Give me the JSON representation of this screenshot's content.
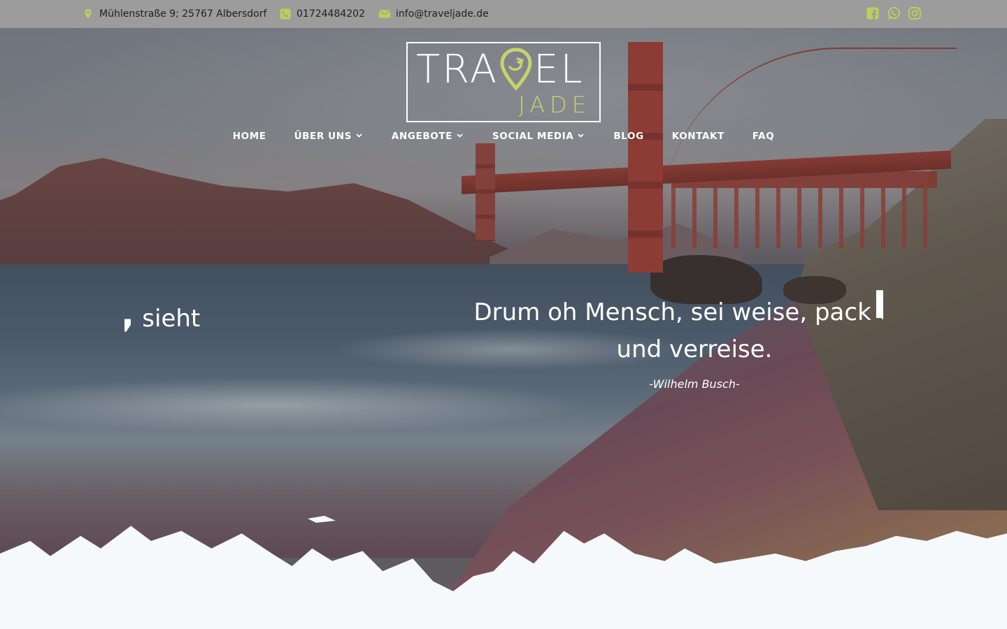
{
  "topbar": {
    "address": "Mühlenstraße 9; 25767 Albersdorf",
    "phone": "01724484202",
    "email": "info@traveljade.de",
    "social_icons": [
      "facebook-icon",
      "whatsapp-icon",
      "instagram-icon"
    ],
    "icon_color": "#bccf5a"
  },
  "logo": {
    "word1": "TRA",
    "word2": "EL",
    "word3": "JADE",
    "accent": "#c7d36b"
  },
  "nav": {
    "items": [
      {
        "label": "HOME",
        "dropdown": false
      },
      {
        "label": "ÜBER UNS",
        "dropdown": true
      },
      {
        "label": "ANGEBOTE",
        "dropdown": true
      },
      {
        "label": "SOCIAL MEDIA",
        "dropdown": true
      },
      {
        "label": "BLOG",
        "dropdown": false
      },
      {
        "label": "KONTAKT",
        "dropdown": false
      },
      {
        "label": "FAQ",
        "dropdown": false
      }
    ]
  },
  "slider": {
    "prev_fragment_big": "st,",
    "prev_fragment": "sieht",
    "quote": "Drum oh Mensch, sei weise, pack die",
    "quote_line2": "und verreise.",
    "author": "-Wilhelm Busch-",
    "next_fragment": "I"
  }
}
